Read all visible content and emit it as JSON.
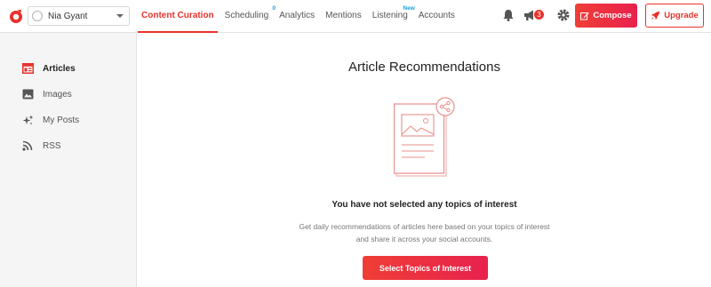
{
  "header": {
    "account_name": "Nia Gyant",
    "nav": [
      {
        "label": "Content Curation",
        "active": true
      },
      {
        "label": "Scheduling",
        "badge": "0"
      },
      {
        "label": "Analytics"
      },
      {
        "label": "Mentions"
      },
      {
        "label": "Listening",
        "badge": "New"
      },
      {
        "label": "Accounts"
      }
    ],
    "notification_count": "3",
    "compose_label": "Compose",
    "upgrade_label": "Upgrade"
  },
  "sidebar": {
    "items": [
      {
        "label": "Articles",
        "icon": "articles-icon",
        "active": true
      },
      {
        "label": "Images",
        "icon": "image-icon"
      },
      {
        "label": "My Posts",
        "icon": "sparkle-icon"
      },
      {
        "label": "RSS",
        "icon": "rss-icon"
      }
    ]
  },
  "main": {
    "title": "Article Recommendations",
    "empty_heading": "You have not selected any topics of interest",
    "empty_description": "Get daily recommendations of articles here based on your topics of interest and share it across your social accounts.",
    "cta_label": "Select Topics of Interest"
  },
  "colors": {
    "accent": "#e8322c",
    "accent_gradient_end": "#e8214e",
    "badge_blue": "#1a9fd8"
  }
}
